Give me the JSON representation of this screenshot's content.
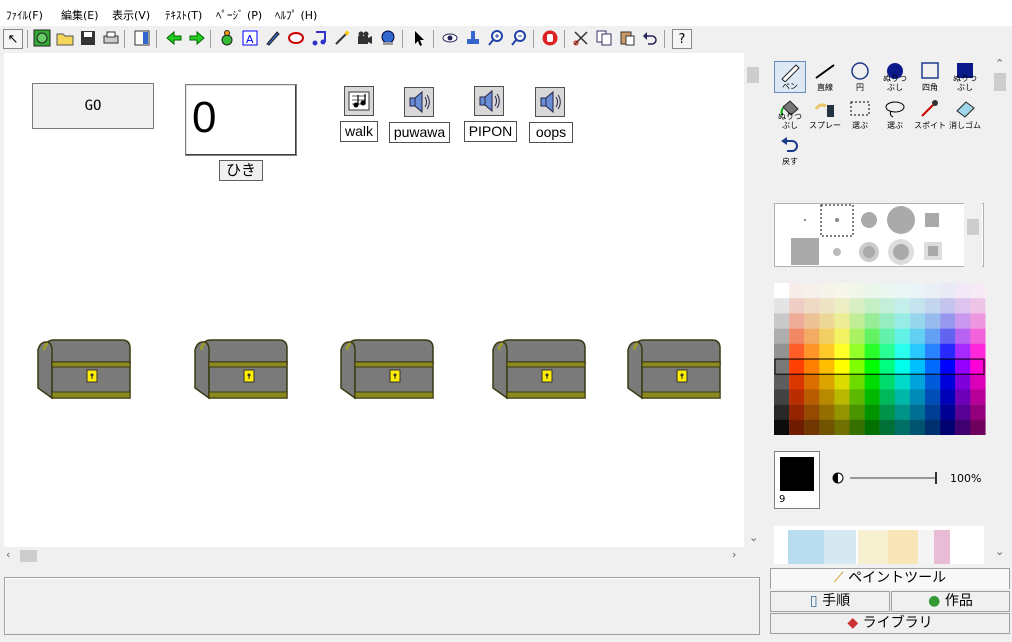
{
  "menu": [
    "ﾌｧｲﾙ(F)",
    "編集(E)",
    "表示(V)",
    "ﾃｷｽﾄ(T)",
    "ﾍﾟｰｼﾞ (P)",
    "ﾍﾙﾌﾟ (H)"
  ],
  "toolbar": {
    "help_label": "?"
  },
  "stage": {
    "go_button": "GO",
    "counter_value": "0",
    "counter_unit": "ひき",
    "sounds": [
      "walk",
      "puwawa",
      "PIPON",
      "oops"
    ]
  },
  "paint": {
    "tools": [
      "ペン",
      "直線",
      "円",
      "ぬりつぶし",
      "四角",
      "ぬりつぶし",
      "ぬりつぶし",
      "スプレー",
      "選ぶ",
      "選ぶ",
      "スポイト",
      "消しゴム",
      "戻す"
    ],
    "brush_size": "9",
    "opacity": "100%"
  },
  "tabs": {
    "paint_tool": "ペイントツール",
    "steps": "手順",
    "works": "作品",
    "library": "ライブラリ"
  },
  "colors": {
    "window_bg": "#f0f0f0",
    "chest_body": "#7a7a7a",
    "chest_trim": "#8a8a20",
    "lock": "#ffee00",
    "selection": "#6b8bb8"
  }
}
